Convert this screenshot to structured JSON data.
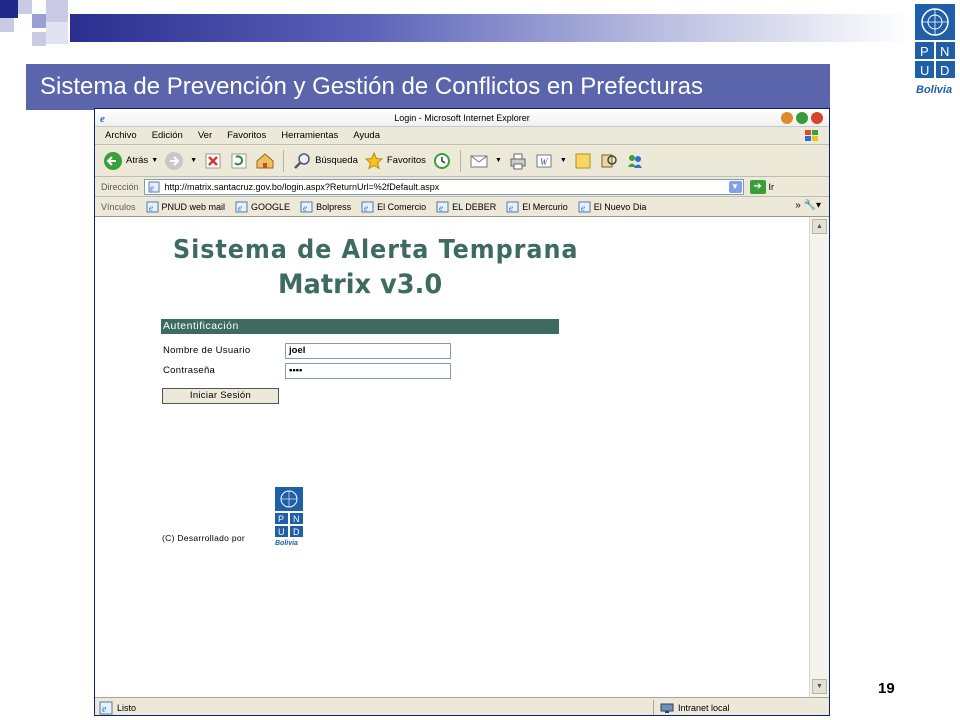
{
  "slide": {
    "title": "Sistema de Prevención y Gestión de Conflictos en Prefecturas",
    "page_number": "19",
    "logo": {
      "line1": "P N",
      "line2": "U D",
      "caption": "Bolivia"
    }
  },
  "browser": {
    "window_title": "Login - Microsoft Internet Explorer",
    "menu": [
      "Archivo",
      "Edición",
      "Ver",
      "Favoritos",
      "Herramientas",
      "Ayuda"
    ],
    "toolbar": {
      "back": "Atrás",
      "search": "Búsqueda",
      "favorites": "Favoritos"
    },
    "address": {
      "label": "Dirección",
      "url": "http://matrix.santacruz.gov.bo/login.aspx?ReturnUrl=%2fDefault.aspx",
      "go": "Ir"
    },
    "links": {
      "label": "Vínculos",
      "items": [
        "PNUD web mail",
        "GOOGLE",
        "Bolpress",
        "El Comercio",
        "EL DEBER",
        "El Mercurio",
        "El Nuevo Dia"
      ]
    },
    "status": {
      "text": "Listo",
      "zone": "Intranet local"
    }
  },
  "page": {
    "heading": "Sistema de Alerta Temprana",
    "subheading": "Matrix v3.0",
    "auth_title": "Autentificación",
    "username_label": "Nombre de Usuario",
    "username_value": "joel",
    "password_label": "Contraseña",
    "password_value": "••••",
    "login_button": "Iniciar Sesión",
    "developed_by": "(C) Desarrollado por",
    "logo": {
      "line1": "P N",
      "line2": "U D",
      "caption": "Bolivia"
    }
  },
  "colors": {
    "title_bar": "#5b65ac",
    "accent_green": "#3d6b61",
    "undp_blue": "#1f5ea8"
  }
}
